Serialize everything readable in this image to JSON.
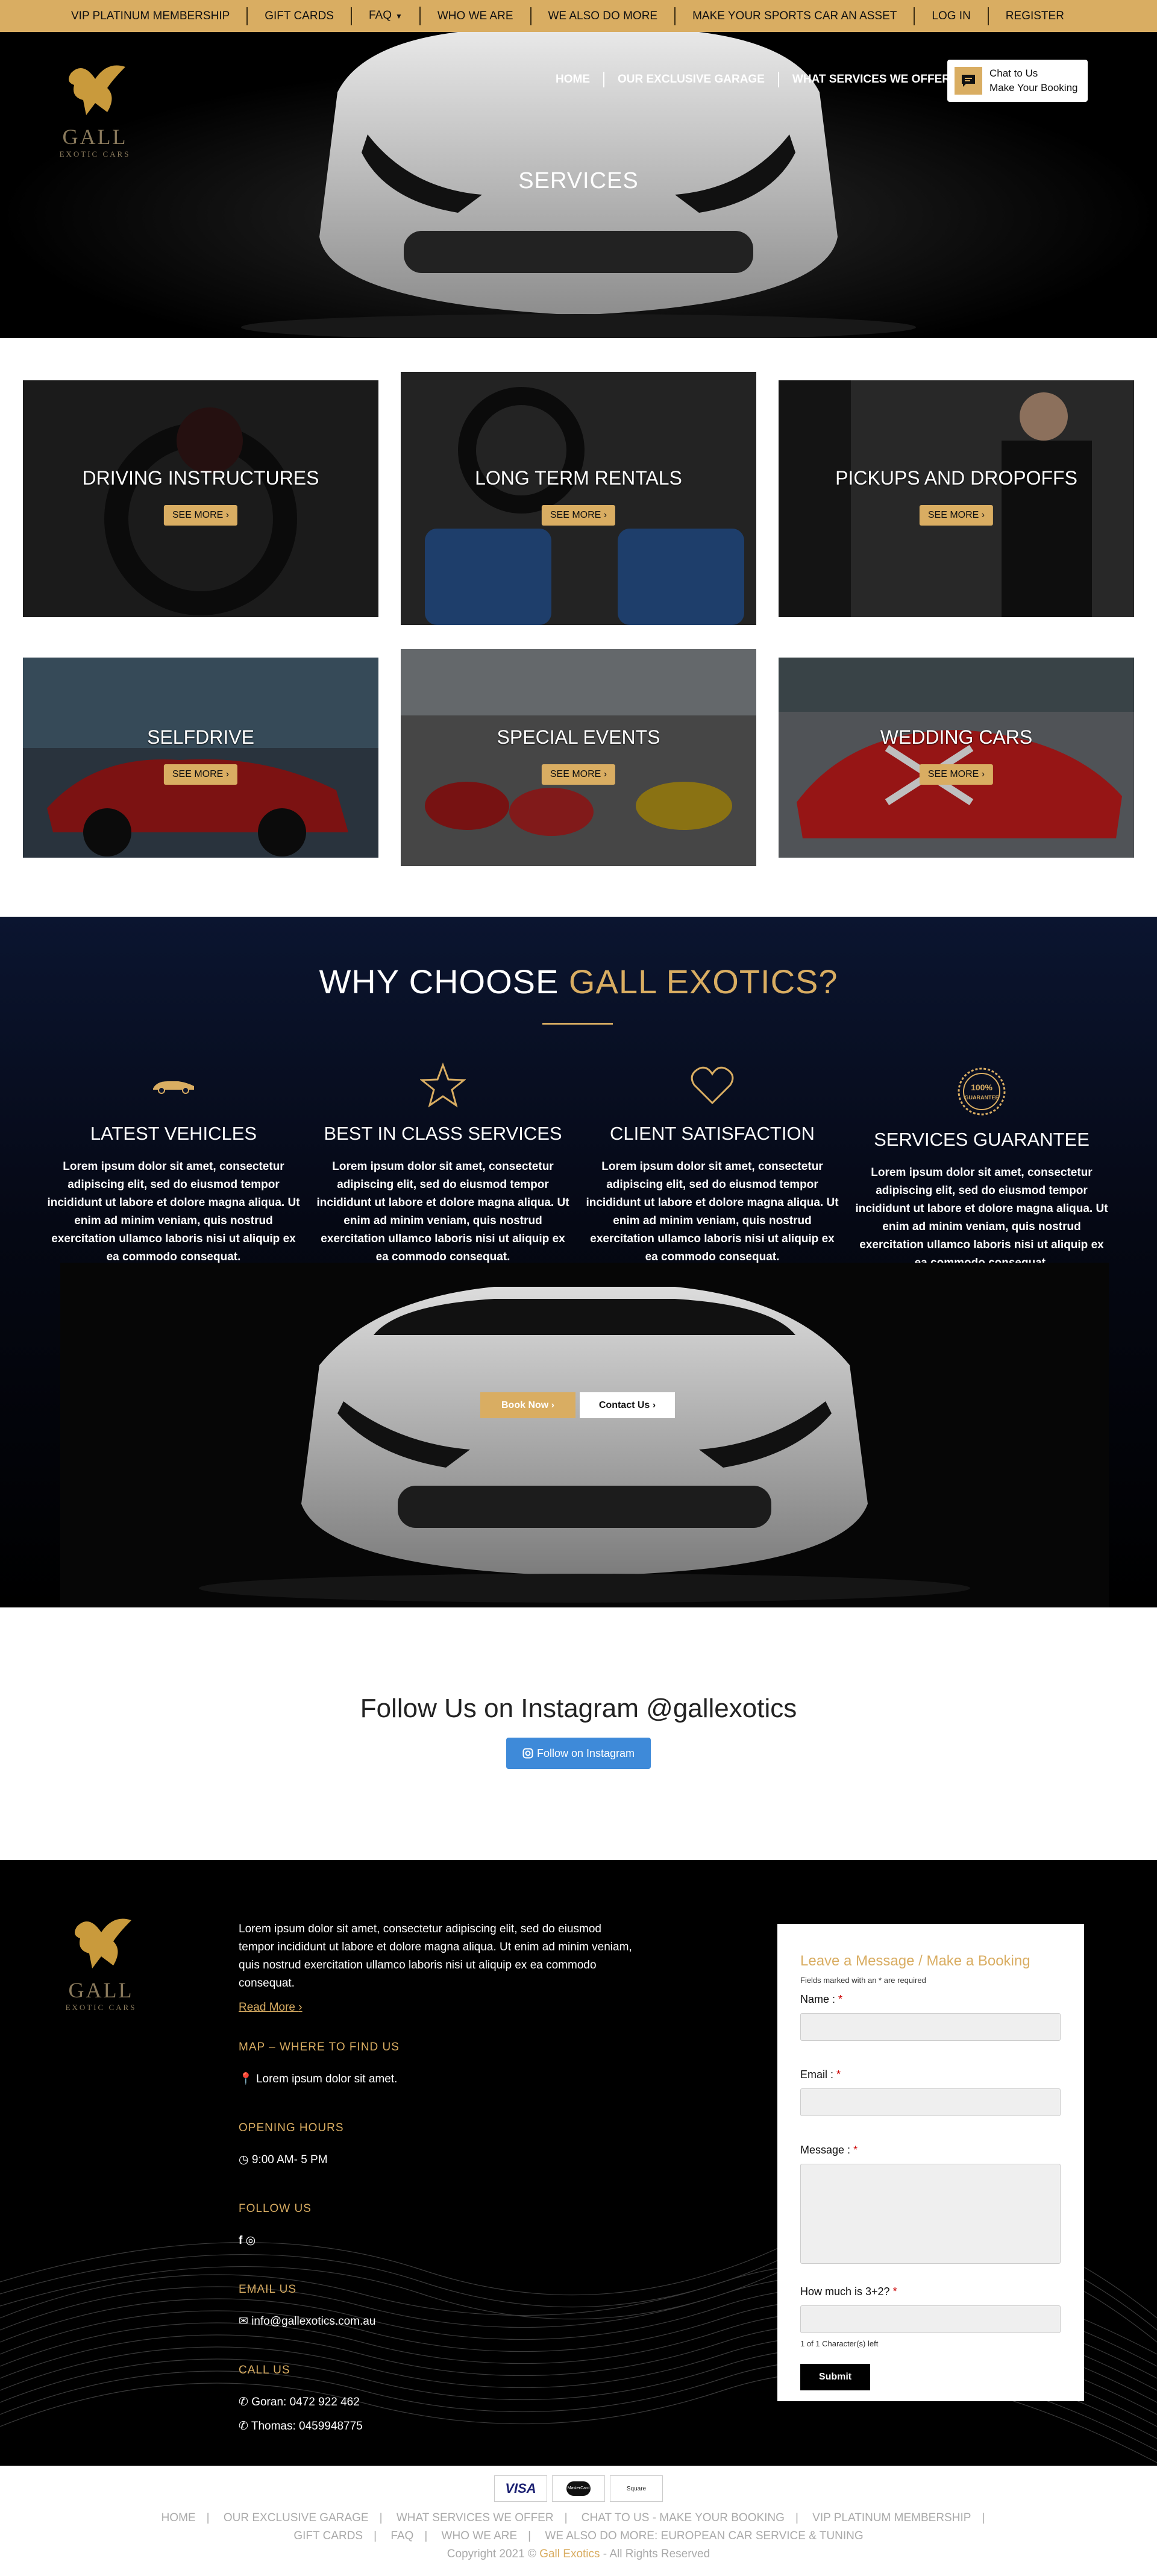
{
  "topbar": {
    "items": [
      "VIP PLATINUM MEMBERSHIP",
      "GIFT CARDS",
      "FAQ",
      "WHO WE ARE",
      "WE ALSO DO MORE",
      "MAKE YOUR SPORTS CAR AN ASSET",
      "LOG IN",
      "REGISTER"
    ]
  },
  "logo": {
    "word": "GALL",
    "sub": "EXOTIC CARS"
  },
  "nav": {
    "items": [
      "HOME",
      "OUR EXCLUSIVE GARAGE",
      "WHAT SERVICES WE OFFER"
    ]
  },
  "chat": {
    "line1": "Chat to Us",
    "line2": "Make Your Booking"
  },
  "hero": {
    "title": "SERVICES"
  },
  "services": {
    "see_more": "SEE MORE",
    "cards": [
      {
        "title": "DRIVING INSTRUCTURES"
      },
      {
        "title": "LONG TERM RENTALS"
      },
      {
        "title": "PICKUPS AND DROPOFFS"
      },
      {
        "title": "SELFDRIVE"
      },
      {
        "title": "SPECIAL EVENTS"
      },
      {
        "title": "WEDDING CARS"
      }
    ]
  },
  "why": {
    "title_white": "WHY CHOOSE ",
    "title_gold": "GALL EXOTICS?",
    "features": [
      {
        "icon": "car-icon",
        "title": "LATEST VEHICLES",
        "text": "Lorem ipsum dolor sit amet, consectetur adipiscing elit, sed do eiusmod tempor incididunt ut labore et dolore magna aliqua. Ut enim ad minim veniam, quis nostrud exercitation ullamco laboris nisi ut aliquip ex ea commodo consequat."
      },
      {
        "icon": "star-icon",
        "title": "BEST IN CLASS SERVICES",
        "text": "Lorem ipsum dolor sit amet, consectetur adipiscing elit, sed do eiusmod tempor incididunt ut labore et dolore magna aliqua. Ut enim ad minim veniam, quis nostrud exercitation ullamco laboris nisi ut aliquip ex ea commodo consequat."
      },
      {
        "icon": "heart-icon",
        "title": "CLIENT SATISFACTION",
        "text": "Lorem ipsum dolor sit amet, consectetur adipiscing elit, sed do eiusmod tempor incididunt ut labore et dolore magna aliqua. Ut enim ad minim veniam, quis nostrud exercitation ullamco laboris nisi ut aliquip ex ea commodo consequat."
      },
      {
        "icon": "guarantee-seal-icon",
        "title": "SERVICES GUARANTEE",
        "text": "Lorem ipsum dolor sit amet, consectetur adipiscing elit, sed do eiusmod tempor incididunt ut labore et dolore magna aliqua. Ut enim ad minim veniam, quis nostrud exercitation ullamco laboris nisi ut aliquip ex ea commodo consequat."
      }
    ],
    "seal_text": "100%",
    "seal_sub": "GUARANTEE",
    "book_now": "Book Now",
    "contact_us": "Contact Us"
  },
  "instagram": {
    "title": "Follow Us on Instagram @gallexotics",
    "button": "Follow on Instagram"
  },
  "footer": {
    "intro": "Lorem ipsum dolor sit amet, consectetur adipiscing elit, sed do eiusmod tempor incididunt ut labore et dolore magna aliqua. Ut enim ad minim veniam, quis nostrud exercitation ullamco laboris nisi ut aliquip ex ea commodo consequat.",
    "read_more": "Read More",
    "map_heading": "MAP – WHERE TO FIND US",
    "map_text": "Lorem ipsum dolor sit amet.",
    "hours_heading": "OPENING HOURS",
    "hours_text": "9:00 AM- 5 PM",
    "follow_heading": "FOLLOW US",
    "email_heading": "EMAIL US",
    "email": "info@gallexotics.com.au",
    "call_heading": "CALL US",
    "phone1": "Goran: 0472 922 462",
    "phone2": "Thomas: 0459948775"
  },
  "form": {
    "heading": "Leave a Message / Make a Booking",
    "note": "Fields marked with an * are required",
    "name_label": "Name :",
    "email_label": "Email :",
    "message_label": "Message :",
    "captcha_label": "How much is 3+2?",
    "char_count": "1 of 1 Character(s) left",
    "submit": "Submit"
  },
  "bottom": {
    "cards": [
      "VISA",
      "MasterCard",
      "Square"
    ],
    "links1": [
      "HOME",
      "OUR EXCLUSIVE GARAGE",
      "WHAT SERVICES WE OFFER",
      "CHAT TO US - MAKE YOUR BOOKING",
      "VIP PLATINUM MEMBERSHIP"
    ],
    "links2": [
      "GIFT CARDS",
      "FAQ",
      "WHO WE ARE",
      "WE ALSO DO MORE: EUROPEAN CAR SERVICE & TUNING"
    ],
    "copy_pre": "Copyright 2021 © ",
    "copy_brand": "Gall Exotics",
    "copy_post": " - All Rights Reserved"
  },
  "colors": {
    "gold": "#d9ad62",
    "black": "#000000",
    "navy": "#0b1530",
    "insta_blue": "#3e8ad9"
  }
}
